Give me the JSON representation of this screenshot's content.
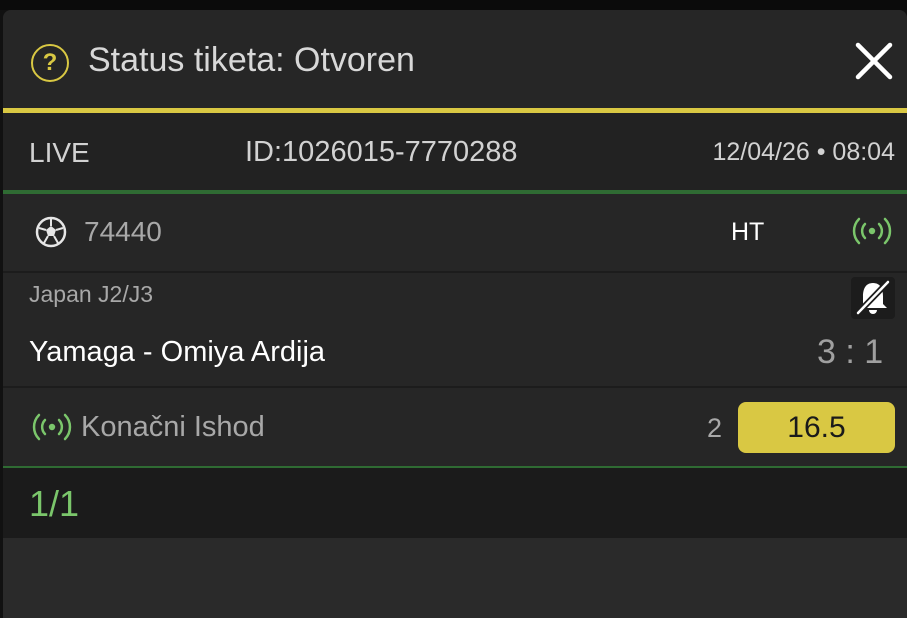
{
  "header": {
    "help_icon": "?",
    "title": "Status tiketa: Otvoren"
  },
  "ticket": {
    "type": "LIVE",
    "id": "ID:1026015-7770288",
    "datetime": "12/04/26 • 08:04"
  },
  "event": {
    "code": "74440",
    "period": "HT",
    "league": "Japan J2/J3",
    "teams": "Yamaga - Omiya Ardija",
    "score": "3 : 1"
  },
  "bet": {
    "market": "Konačni Ishod",
    "pick": "2",
    "odds": "16.5"
  },
  "summary": {
    "count": "1/1"
  },
  "colors": {
    "accent_yellow": "#d9c843",
    "live_green": "#7bc66b",
    "background": "#262626"
  },
  "icons": [
    "help-icon",
    "close-icon",
    "soccer-ball-icon",
    "live-signal-icon",
    "bell-off-icon"
  ]
}
